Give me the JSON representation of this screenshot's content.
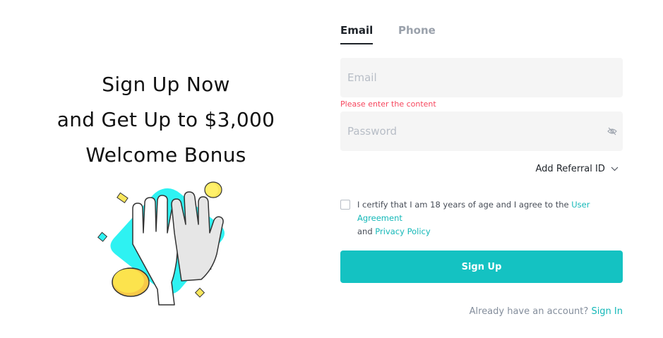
{
  "promo": {
    "line1": "Sign Up Now",
    "line2": "and Get Up to $3,000",
    "line3": "Welcome Bonus"
  },
  "tabs": {
    "email": "Email",
    "phone": "Phone"
  },
  "form": {
    "email_placeholder": "Email",
    "email_error": "Please enter the content",
    "password_placeholder": "Password",
    "referral_label": "Add Referral ID",
    "agree_prefix": "I certify that I am 18 years of age and I agree to the",
    "user_agreement": "User Agreement",
    "and_word": "and",
    "privacy_policy": "Privacy Policy",
    "submit_label": "Sign Up"
  },
  "footer": {
    "question": "Already have an account?",
    "signin": "Sign In"
  },
  "colors": {
    "accent": "#14c2c2",
    "error": "#f6465d",
    "link": "#14b8b8"
  }
}
